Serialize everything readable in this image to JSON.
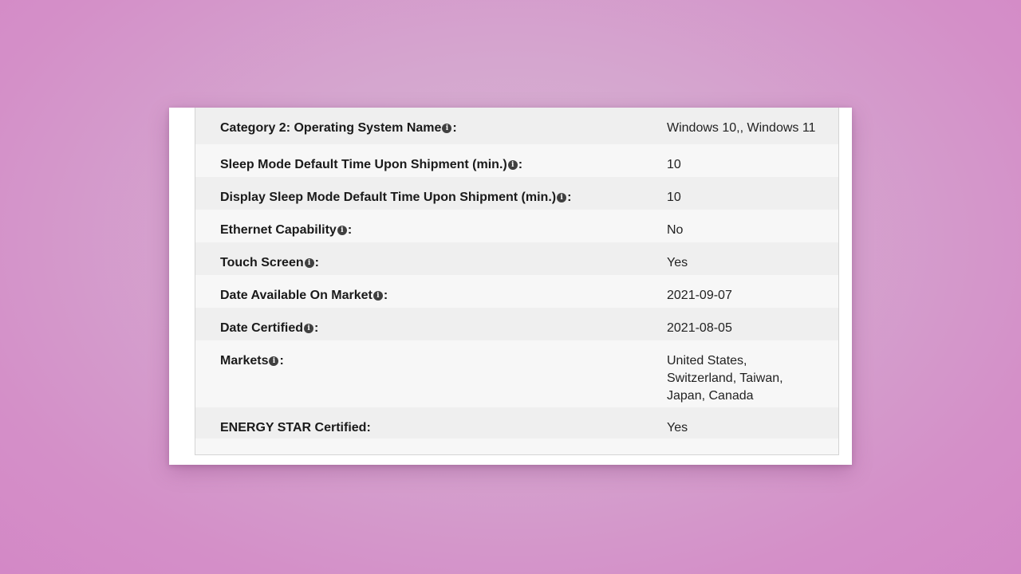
{
  "specs": {
    "rows": [
      {
        "label": "Category 2: Operating System Name",
        "has_info": true,
        "value": "Windows 10,, Windows 11"
      },
      {
        "label": "Sleep Mode Default Time Upon Shipment (min.)",
        "has_info": true,
        "value": "10"
      },
      {
        "label": "Display Sleep Mode Default Time Upon Shipment (min.)",
        "has_info": true,
        "value": "10"
      },
      {
        "label": "Ethernet Capability",
        "has_info": true,
        "value": "No"
      },
      {
        "label": "Touch Screen",
        "has_info": true,
        "value": "Yes"
      },
      {
        "label": "Date Available On Market",
        "has_info": true,
        "value": "2021-09-07"
      },
      {
        "label": "Date Certified",
        "has_info": true,
        "value": "2021-08-05"
      },
      {
        "label": "Markets",
        "has_info": true,
        "value": "United States, Switzerland, Taiwan, Japan, Canada"
      },
      {
        "label": "ENERGY STAR Certified",
        "has_info": false,
        "value": "Yes"
      }
    ],
    "label_suffix": ":",
    "info_icon_glyph": "i",
    "info_icon_name": "info-icon"
  },
  "colors": {
    "background": "#d48fc8",
    "row_odd": "#efefef",
    "row_even": "#f7f7f7",
    "icon": "#404040"
  }
}
